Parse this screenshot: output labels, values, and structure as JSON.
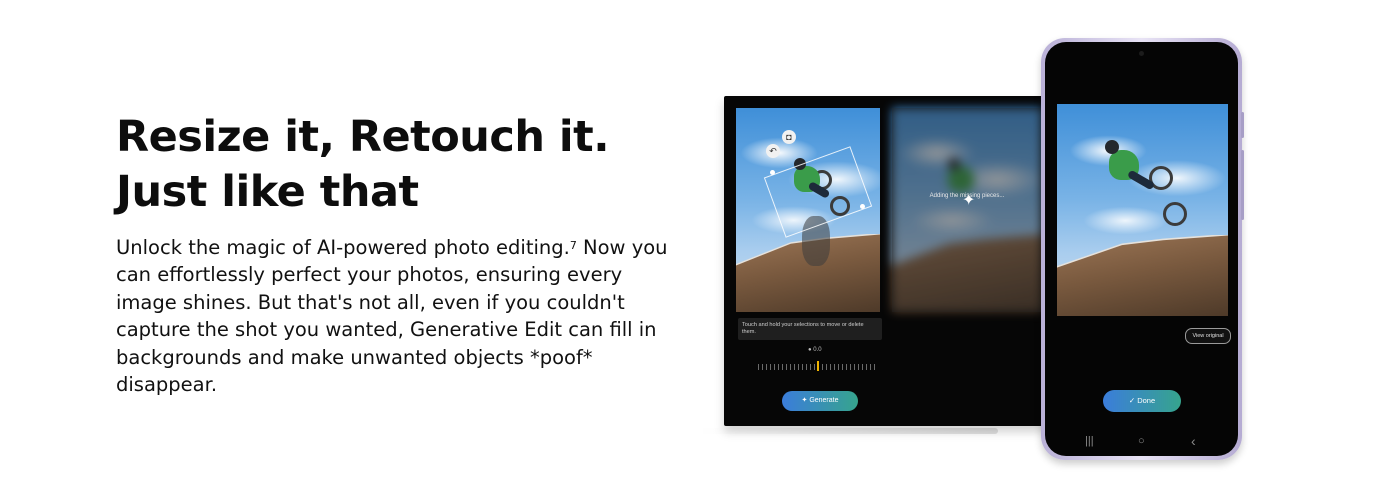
{
  "headline": {
    "line1": "Resize it, Retouch it.",
    "line2": "Just like that"
  },
  "body": {
    "part1": "Unlock the magic of AI-powered photo editing.",
    "footnote": "7",
    "part2": " Now you can effortlessly perfect your photos, ensuring every image shines. But that's not all, even if you couldn't capture the shot you wanted, Generative Edit can fill in backgrounds and make unwanted objects *poof* disappear."
  },
  "tablet_screen": {
    "hint": "Touch and hold your selections to move or delete them.",
    "slider_value": "0.0",
    "generate_label": "Generate",
    "status_text": "Adding the missing pieces...",
    "sparkle_icon": "sparkle-icon"
  },
  "phone_screen": {
    "view_original_label": "View original",
    "done_label": "Done",
    "nav_icons": [
      "recents-icon",
      "home-icon",
      "back-icon"
    ],
    "nav_glyphs": [
      "|||",
      "○",
      "‹"
    ]
  },
  "colors": {
    "button_gradient_start": "#3b7ddb",
    "button_gradient_end": "#36a48d",
    "phone_frame": "#c9c1e3"
  }
}
